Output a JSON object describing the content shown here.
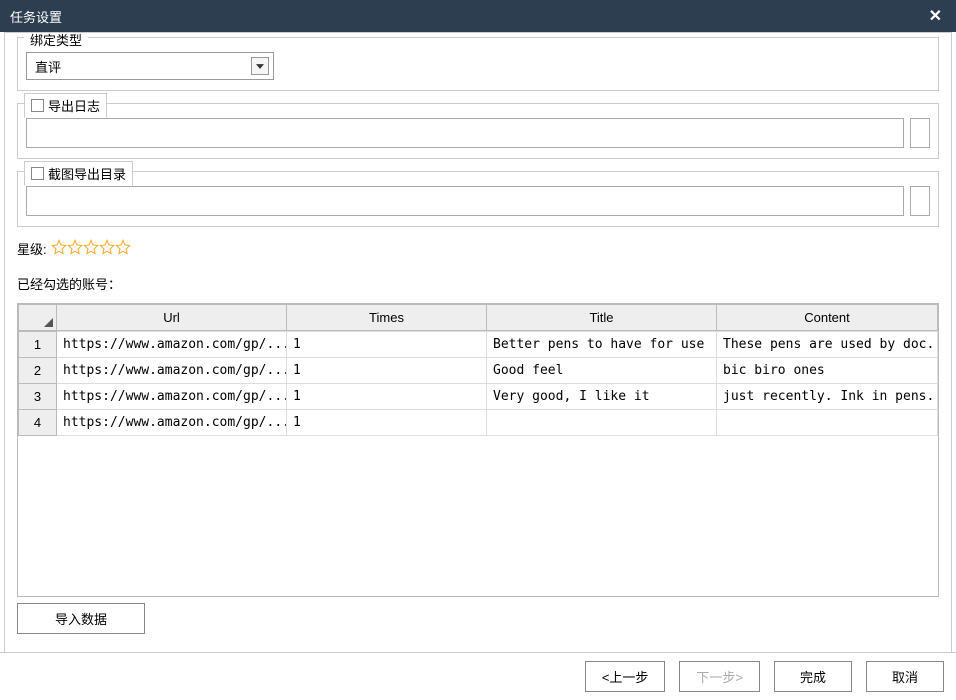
{
  "titlebar": {
    "title": "任务设置",
    "close": "✕"
  },
  "bindType": {
    "label": "绑定类型",
    "value": "直评"
  },
  "exportLog": {
    "label": "导出日志",
    "value": ""
  },
  "screenshotDir": {
    "label": "截图导出目录",
    "value": ""
  },
  "rating": {
    "label": "星级:"
  },
  "accountsLabel": "已经勾选的账号：",
  "grid": {
    "columns": [
      "Url",
      "Times",
      "Title",
      "Content"
    ],
    "rows": [
      {
        "n": "1",
        "url": "https://www.amazon.com/gp/...",
        "times": "1",
        "title": " Better pens to have for use",
        "content": "These pens are used by doc..."
      },
      {
        "n": "2",
        "url": "https://www.amazon.com/gp/...",
        "times": "1",
        "title": "Good feel",
        "content": "bic biro ones"
      },
      {
        "n": "3",
        "url": "https://www.amazon.com/gp/...",
        "times": "1",
        "title": "Very good, I like it",
        "content": "just recently. Ink in pens..."
      },
      {
        "n": "4",
        "url": "https://www.amazon.com/gp/...",
        "times": "1",
        "title": "",
        "content": ""
      }
    ]
  },
  "buttons": {
    "importData": "导入数据",
    "prev": "<上一步",
    "next": "下一步>",
    "finish": "完成",
    "cancel": "取消"
  }
}
